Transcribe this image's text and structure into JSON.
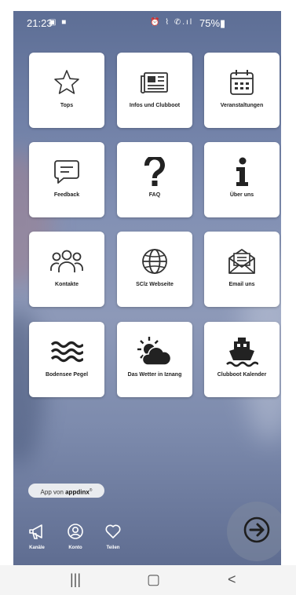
{
  "status_bar": {
    "time": "21:23",
    "left_icons": "▣ ■",
    "right_icons": "⏰ ⌇ ✆.ıl",
    "battery": "75%▮"
  },
  "tiles": [
    {
      "label": "Tops",
      "icon": "star-icon"
    },
    {
      "label": "Infos und Clubboot",
      "icon": "newspaper-icon"
    },
    {
      "label": "Veranstaltungen",
      "icon": "calendar-icon"
    },
    {
      "label": "Feedback",
      "icon": "feedback-icon"
    },
    {
      "label": "FAQ",
      "icon": "question-mark-icon"
    },
    {
      "label": "Über uns",
      "icon": "info-icon"
    },
    {
      "label": "Kontakte",
      "icon": "contacts-icon"
    },
    {
      "label": "SClz Webseite",
      "icon": "globe-icon"
    },
    {
      "label": "Email uns",
      "icon": "email-icon"
    },
    {
      "label": "Bodensee Pegel",
      "icon": "water-waves-icon"
    },
    {
      "label": "Das Wetter in Iznang",
      "icon": "weather-icon"
    },
    {
      "label": "Clubboot Kalender",
      "icon": "ship-icon"
    }
  ],
  "badge": {
    "prefix": "App von ",
    "brand": "appdinx",
    "mark": "®"
  },
  "bottom_nav": [
    {
      "label": "Kanäle",
      "icon": "megaphone-icon"
    },
    {
      "label": "Konto",
      "icon": "account-icon"
    },
    {
      "label": "Teilen",
      "icon": "heart-icon"
    }
  ],
  "fab": {
    "icon": "arrow-right-circle-icon"
  },
  "system_nav": {
    "recent": "|||",
    "home": "▢",
    "back": "<"
  }
}
